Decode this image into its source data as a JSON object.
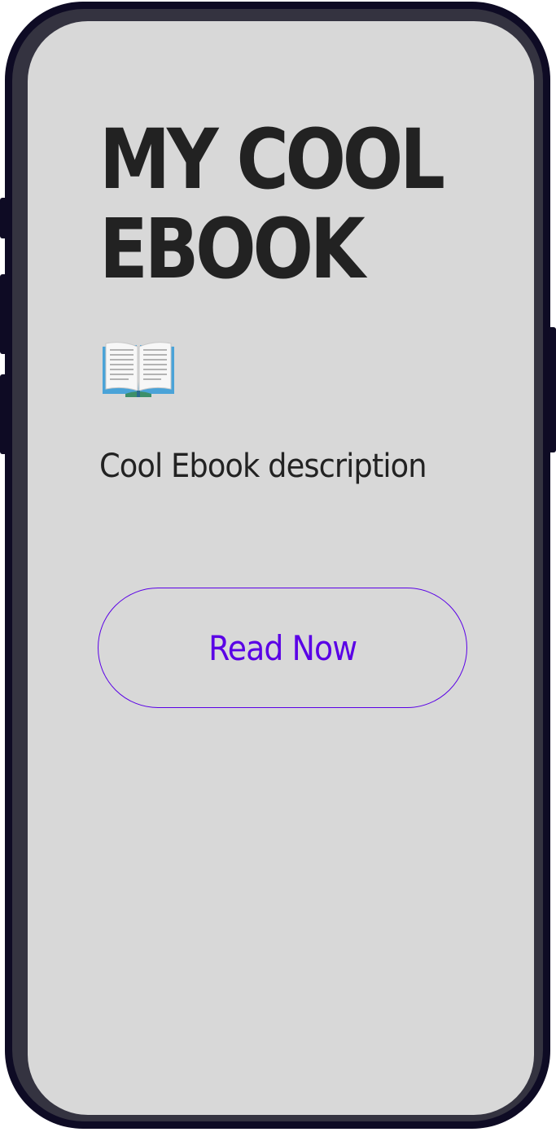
{
  "ebook": {
    "title": "MY COOL\nEBOOK",
    "icon": "open-book-icon",
    "description": "Cool Ebook description",
    "read_button_label": "Read Now"
  },
  "colors": {
    "screen_background": "#d8d8d8",
    "text": "#222222",
    "accent": "#5a00e6",
    "phone_frame": "#0e0b24",
    "phone_bezel": "#343340"
  }
}
